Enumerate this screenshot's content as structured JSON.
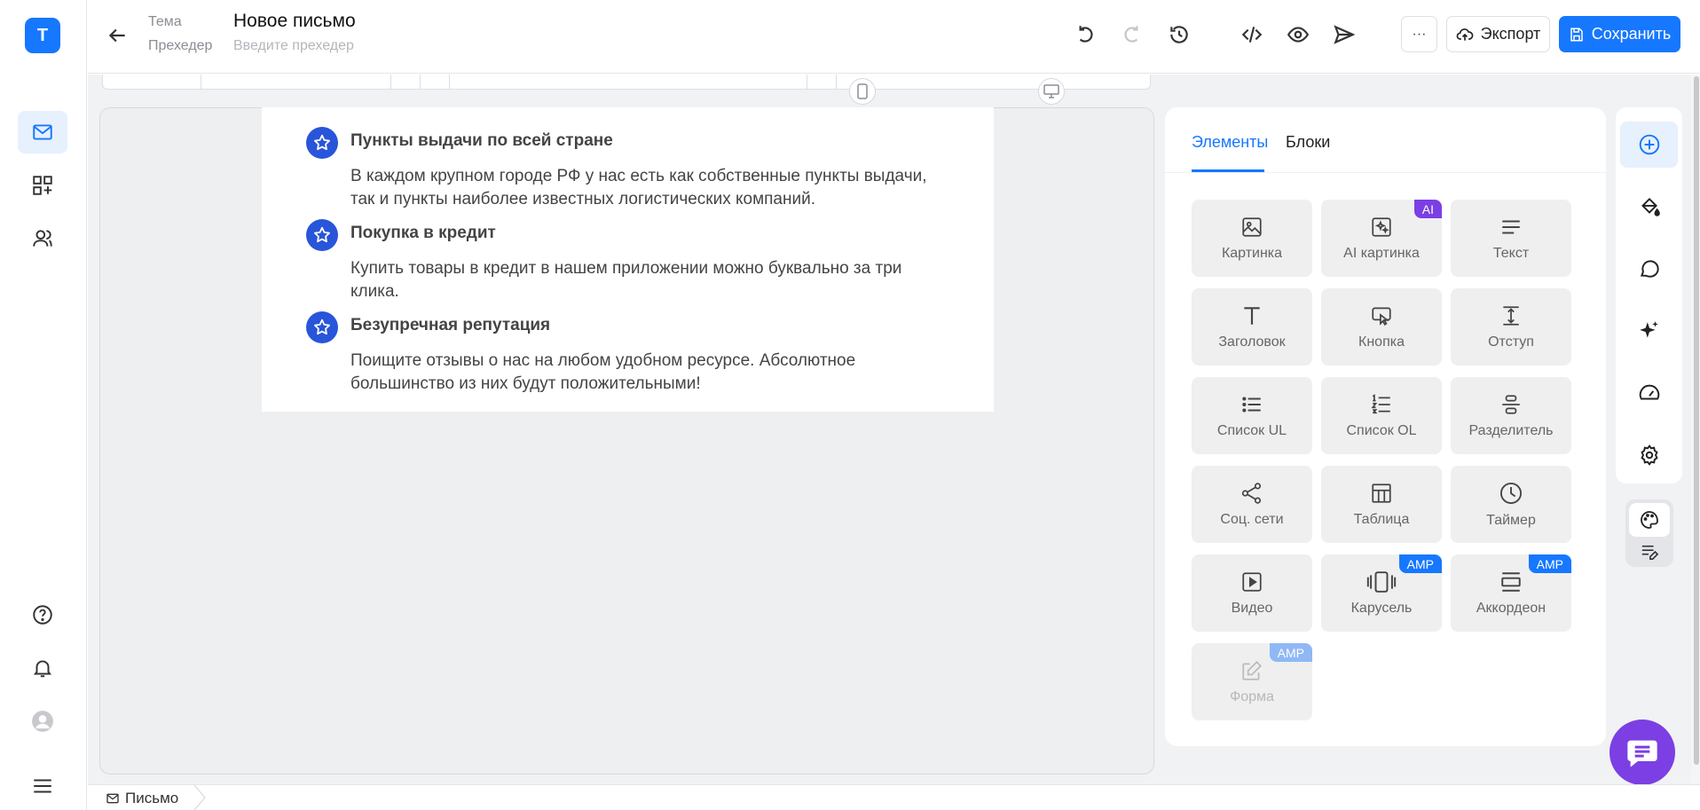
{
  "app": {
    "logo_letter": "T",
    "accent": "#1677ff",
    "purple": "#7b3fe4"
  },
  "rail": {
    "items": [
      {
        "name": "mail-icon",
        "active": true
      },
      {
        "name": "widgets-icon",
        "active": false
      },
      {
        "name": "users-icon",
        "active": false
      }
    ],
    "bottom": [
      "help-icon",
      "bell-icon",
      "avatar",
      "menu-icon"
    ]
  },
  "header": {
    "subject_label": "Тема",
    "subject_value": "Новое письмо",
    "preheader_label": "Прехедер",
    "preheader_placeholder": "Введите прехедер",
    "more_label": "···",
    "export_label": "Экспорт",
    "save_label": "Сохранить"
  },
  "email": {
    "features": [
      {
        "title": "Пункты выдачи по всей стране",
        "text": "В каждом крупном городе РФ у нас есть как собственные пункты выдачи, так и пункты наиболее известных логистических компаний."
      },
      {
        "title": "Покупка в кредит",
        "text": "Купить товары в кредит в нашем приложении можно буквально за три клика."
      },
      {
        "title": "Безупречная репутация",
        "text": "Поищите отзывы о нас на любом удобном ресурсе. Абсолютное большинство из них будут положительными!"
      }
    ]
  },
  "panel": {
    "tabs": [
      {
        "label": "Элементы",
        "active": true
      },
      {
        "label": "Блоки",
        "active": false
      }
    ],
    "tiles": [
      {
        "label": "Картинка",
        "icon": "image-icon"
      },
      {
        "label": "AI картинка",
        "icon": "ai-image-icon",
        "badge": "AI",
        "badge_color": "#7b3fe4"
      },
      {
        "label": "Текст",
        "icon": "text-icon"
      },
      {
        "label": "Заголовок",
        "icon": "heading-icon"
      },
      {
        "label": "Кнопка",
        "icon": "button-icon"
      },
      {
        "label": "Отступ",
        "icon": "spacer-icon"
      },
      {
        "label": "Список UL",
        "icon": "list-ul-icon"
      },
      {
        "label": "Список OL",
        "icon": "list-ol-icon"
      },
      {
        "label": "Разделитель",
        "icon": "divider-icon"
      },
      {
        "label": "Соц. сети",
        "icon": "share-icon"
      },
      {
        "label": "Таблица",
        "icon": "table-icon"
      },
      {
        "label": "Таймер",
        "icon": "clock-icon"
      },
      {
        "label": "Видео",
        "icon": "video-icon"
      },
      {
        "label": "Карусель",
        "icon": "carousel-icon",
        "badge": "AMP",
        "badge_color": "#1677ff"
      },
      {
        "label": "Аккордеон",
        "icon": "accordion-icon",
        "badge": "AMP",
        "badge_color": "#1677ff"
      },
      {
        "label": "Форма",
        "icon": "form-icon",
        "badge": "AMP",
        "badge_color": "#8fb8f5",
        "disabled": true
      }
    ]
  },
  "tools": [
    "add-icon",
    "paint-bucket-icon",
    "chat-icon",
    "sparkles-icon",
    "gauge-icon",
    "gear-icon"
  ],
  "footer": {
    "crumb": "Письмо"
  }
}
